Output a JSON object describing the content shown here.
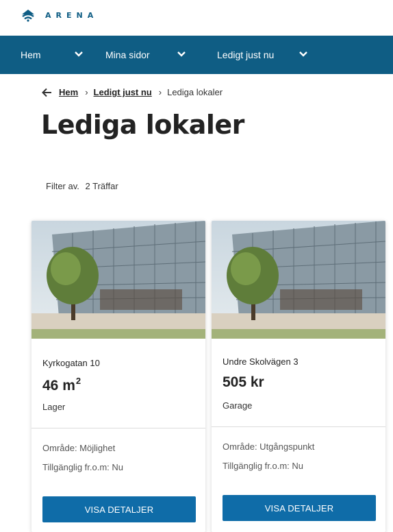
{
  "brand": {
    "name": "ARENA",
    "icon": "wifi-dome-icon",
    "color": "#0f5d84"
  },
  "nav": {
    "items": [
      {
        "label": "Hem"
      },
      {
        "label": "Mina sidor"
      },
      {
        "label": "Ledigt just nu"
      }
    ]
  },
  "breadcrumb": {
    "back_icon": "arrow-left-icon",
    "items": [
      "Hem",
      "Ledigt just nu",
      "Lediga lokaler"
    ]
  },
  "page": {
    "title": "Lediga lokaler",
    "filter_label": "Filter av.",
    "hits": "2 Träffar"
  },
  "cards": [
    {
      "name": "Kyrkogatan 10",
      "value": "46 m",
      "value_sup": "2",
      "type": "Lager",
      "area": "Område: Möjlighet",
      "available": "Tillgänglig fr.o.m: Nu",
      "button": "VISA DETALJER"
    },
    {
      "name": "Undre Skolvägen 3",
      "value": "505 kr",
      "value_sup": "",
      "type": "Garage",
      "area": "Område: Utgångspunkt",
      "available": "Tillgänglig fr.o.m: Nu",
      "button": "VISA DETALJER"
    }
  ],
  "colors": {
    "nav_bg": "#0f5d84",
    "button_bg": "#0f6ca8"
  }
}
